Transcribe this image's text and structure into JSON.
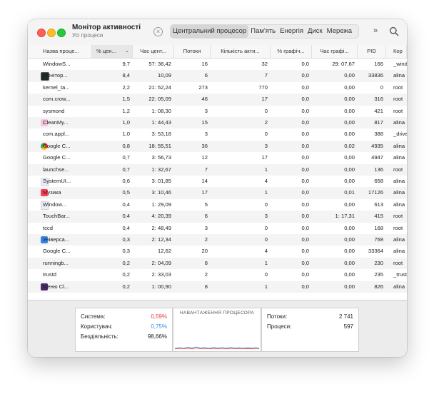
{
  "app": {
    "title": "Монітор активності",
    "subtitle": "Усі процеси"
  },
  "toolbar": {
    "tabs": [
      {
        "label": "Центральний процесор",
        "active": true
      },
      {
        "label": "Пам'ять",
        "active": false
      },
      {
        "label": "Енергія",
        "active": false
      },
      {
        "label": "Диск",
        "active": false
      },
      {
        "label": "Мережа",
        "active": false
      }
    ],
    "more_label": "»"
  },
  "columns": [
    "Назва проце...",
    "% цен...",
    "Час цент...",
    "Потоки",
    "Кількість акти...",
    "% графіч...",
    "Час графі...",
    "PID",
    "Кор"
  ],
  "processes": [
    {
      "name": "WindowS...",
      "icon": "",
      "cpu": "9,7",
      "time": "57: 36,42",
      "threads": "16",
      "wake": "32",
      "gpu": "0,0",
      "gputime": "29: 07,67",
      "pid": "166",
      "user": "_wind"
    },
    {
      "name": "Монітор...",
      "icon": "activity-monitor-icon",
      "cpu": "8,4",
      "time": "10,09",
      "threads": "6",
      "wake": "7",
      "gpu": "0,0",
      "gputime": "0,00",
      "pid": "33836",
      "user": "alina"
    },
    {
      "name": "kernel_ta...",
      "icon": "",
      "cpu": "2,2",
      "time": "21: 52,24",
      "threads": "273",
      "wake": "770",
      "gpu": "0,0",
      "gputime": "0,00",
      "pid": "0",
      "user": "root"
    },
    {
      "name": "com.crow...",
      "icon": "",
      "cpu": "1,5",
      "time": "22: 05,09",
      "threads": "46",
      "wake": "17",
      "gpu": "0,0",
      "gputime": "0,00",
      "pid": "316",
      "user": "root"
    },
    {
      "name": "sysmond",
      "icon": "",
      "cpu": "1,2",
      "time": "1: 08,30",
      "threads": "3",
      "wake": "0",
      "gpu": "0,0",
      "gputime": "0,00",
      "pid": "421",
      "user": "root"
    },
    {
      "name": "CleanMy...",
      "icon": "cleanmymac-icon",
      "cpu": "1,0",
      "time": "1: 44,43",
      "threads": "15",
      "wake": "2",
      "gpu": "0,0",
      "gputime": "0,00",
      "pid": "817",
      "user": "alina"
    },
    {
      "name": "com.appl...",
      "icon": "",
      "cpu": "1,0",
      "time": "3: 53,18",
      "threads": "3",
      "wake": "0",
      "gpu": "0,0",
      "gputime": "0,00",
      "pid": "388",
      "user": "_drive"
    },
    {
      "name": "Google C...",
      "icon": "chrome-icon",
      "cpu": "0,8",
      "time": "18: 55,51",
      "threads": "36",
      "wake": "3",
      "gpu": "0,0",
      "gputime": "0,02",
      "pid": "4935",
      "user": "alina"
    },
    {
      "name": "Google C...",
      "icon": "",
      "cpu": "0,7",
      "time": "3: 56,73",
      "threads": "12",
      "wake": "17",
      "gpu": "0,0",
      "gputime": "0,00",
      "pid": "4947",
      "user": "alina"
    },
    {
      "name": "launchse...",
      "icon": "",
      "cpu": "0,7",
      "time": "1: 32,67",
      "threads": "7",
      "wake": "1",
      "gpu": "0,0",
      "gputime": "0,00",
      "pid": "136",
      "user": "root"
    },
    {
      "name": "SystemUI...",
      "icon": "generic-app-icon",
      "cpu": "0,6",
      "time": "3: 01,85",
      "threads": "14",
      "wake": "4",
      "gpu": "0,0",
      "gputime": "0,00",
      "pid": "658",
      "user": "alina"
    },
    {
      "name": "Музика",
      "icon": "music-icon",
      "cpu": "0,5",
      "time": "3: 10,46",
      "threads": "17",
      "wake": "1",
      "gpu": "0,0",
      "gputime": "0,01",
      "pid": "17126",
      "user": "alina"
    },
    {
      "name": "Window...",
      "icon": "generic-app-icon",
      "cpu": "0,4",
      "time": "1: 29,09",
      "threads": "5",
      "wake": "0",
      "gpu": "0,0",
      "gputime": "0,00",
      "pid": "613",
      "user": "alina"
    },
    {
      "name": "TouchBar...",
      "icon": "",
      "cpu": "0,4",
      "time": "4: 20,39",
      "threads": "6",
      "wake": "3",
      "gpu": "0,0",
      "gputime": "1: 17,31",
      "pid": "415",
      "user": "root"
    },
    {
      "name": "tccd",
      "icon": "",
      "cpu": "0,4",
      "time": "2: 48,49",
      "threads": "3",
      "wake": "0",
      "gpu": "0,0",
      "gputime": "0,00",
      "pid": "168",
      "user": "root"
    },
    {
      "name": "Універса...",
      "icon": "universal-control-icon",
      "cpu": "0,3",
      "time": "2: 12,34",
      "threads": "2",
      "wake": "0",
      "gpu": "0,0",
      "gputime": "0,00",
      "pid": "768",
      "user": "alina"
    },
    {
      "name": "Google C...",
      "icon": "",
      "cpu": "0,3",
      "time": "12,62",
      "threads": "20",
      "wake": "4",
      "gpu": "0,0",
      "gputime": "0,00",
      "pid": "33364",
      "user": "alina"
    },
    {
      "name": "runningb...",
      "icon": "",
      "cpu": "0,2",
      "time": "2: 04,09",
      "threads": "8",
      "wake": "1",
      "gpu": "0,0",
      "gputime": "0,00",
      "pid": "230",
      "user": "root"
    },
    {
      "name": "trustd",
      "icon": "",
      "cpu": "0,2",
      "time": "2: 33,03",
      "threads": "2",
      "wake": "0",
      "gpu": "0,0",
      "gputime": "0,00",
      "pid": "235",
      "user": "_trust"
    },
    {
      "name": "Меню Cl...",
      "icon": "cleanmymac-menu-icon",
      "cpu": "0,2",
      "time": "1: 00,90",
      "threads": "8",
      "wake": "1",
      "gpu": "0,0",
      "gputime": "0,00",
      "pid": "826",
      "user": "alina"
    }
  ],
  "stats": {
    "system_label": "Система:",
    "system_value": "0,59%",
    "user_label": "Користувач:",
    "user_value": "0,75%",
    "idle_label": "Бездіяльність:",
    "idle_value": "98,66%",
    "graph_title": "НАВАНТАЖЕННЯ ПРОЦЕСОРА",
    "threads_label": "Потоки:",
    "threads_value": "2 741",
    "processes_label": "Процеси:",
    "processes_value": "597"
  },
  "colors": {
    "system": "#e0443e",
    "user": "#3b8de0"
  }
}
